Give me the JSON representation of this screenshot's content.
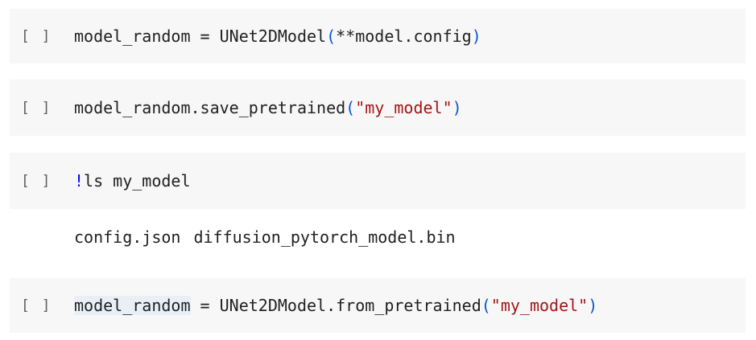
{
  "cells": [
    {
      "run_label": "[ ]",
      "code": {
        "var": "model_random",
        "op": " = ",
        "call": "UNet2DModel",
        "lparen": "(",
        "arg": "**model.config",
        "rparen": ")"
      }
    },
    {
      "run_label": "[ ]",
      "code": {
        "var": "model_random",
        "call": ".save_pretrained",
        "lparen": "(",
        "arg": "\"my_model\"",
        "rparen": ")"
      }
    },
    {
      "run_label": "[ ]",
      "code": {
        "magic": "!",
        "cmd": "ls my_model"
      },
      "output": [
        "config.json",
        "diffusion_pytorch_model.bin"
      ]
    },
    {
      "run_label": "[ ]",
      "code": {
        "var": "model_random",
        "op": " = ",
        "call": "UNet2DModel.from_pretrained",
        "lparen": "(",
        "arg": "\"my_model\"",
        "rparen": ")"
      }
    }
  ],
  "colors": {
    "cell_bg": "#f7f7f7",
    "paren": "#0b57d0",
    "string": "#a31515",
    "magic": "#0000ff",
    "text": "#212121",
    "run_button": "#616161"
  }
}
